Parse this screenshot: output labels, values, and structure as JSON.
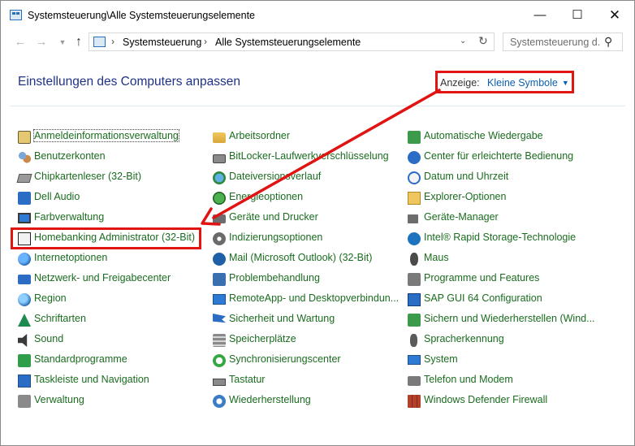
{
  "window": {
    "title": "Systemsteuerung\\Alle Systemsteuerungselemente"
  },
  "address": {
    "crumbs": [
      "Systemsteuerung",
      "Alle Systemsteuerungselemente"
    ],
    "search_placeholder": "Systemsteuerung d..."
  },
  "header": {
    "title": "Einstellungen des Computers anpassen",
    "view_label": "Anzeige:",
    "view_value": "Kleine Symbole"
  },
  "colors": {
    "link_green": "#1a6c1f",
    "title_blue": "#1e3287",
    "accent_blue": "#0a5fb0",
    "highlight_red": "#e11414"
  },
  "columns": [
    {
      "items": [
        {
          "label": "Anmeldeinformationsverwaltung",
          "icon": "credential-manager-icon",
          "kind": "panel",
          "focused": true
        },
        {
          "label": "Benutzerkonten",
          "icon": "user-accounts-icon",
          "kind": "users"
        },
        {
          "label": "Chipkartenleser (32-Bit)",
          "icon": "smart-card-reader-icon",
          "kind": "card"
        },
        {
          "label": "Dell Audio",
          "icon": "dell-audio-icon",
          "kind": "dell"
        },
        {
          "label": "Farbverwaltung",
          "icon": "color-management-icon",
          "kind": "monitor"
        },
        {
          "label": "Homebanking Administrator (32-Bit)",
          "icon": "homebanking-icon",
          "kind": "bank"
        },
        {
          "label": "Internetoptionen",
          "icon": "internet-options-icon",
          "kind": "globe"
        },
        {
          "label": "Netzwerk- und Freigabecenter",
          "icon": "network-icon",
          "kind": "network"
        },
        {
          "label": "Region",
          "icon": "region-icon",
          "kind": "region"
        },
        {
          "label": "Schriftarten",
          "icon": "fonts-icon",
          "kind": "font"
        },
        {
          "label": "Sound",
          "icon": "sound-icon",
          "kind": "speaker"
        },
        {
          "label": "Standardprogramme",
          "icon": "default-programs-icon",
          "kind": "default"
        },
        {
          "label": "Taskleiste und Navigation",
          "icon": "taskbar-icon",
          "kind": "taskbar"
        },
        {
          "label": "Verwaltung",
          "icon": "administrative-tools-icon",
          "kind": "admin"
        }
      ]
    },
    {
      "items": [
        {
          "label": "Arbeitsordner",
          "icon": "work-folders-icon",
          "kind": "folder"
        },
        {
          "label": "BitLocker-Laufwerkverschlüsselung",
          "icon": "bitlocker-icon",
          "kind": "lock"
        },
        {
          "label": "Dateiversionsverlauf",
          "icon": "file-history-icon",
          "kind": "clockglobe"
        },
        {
          "label": "Energieoptionen",
          "icon": "power-options-icon",
          "kind": "play"
        },
        {
          "label": "Geräte und Drucker",
          "icon": "devices-printers-icon",
          "kind": "printer"
        },
        {
          "label": "Indizierungsoptionen",
          "icon": "indexing-options-icon",
          "kind": "gear"
        },
        {
          "label": "Mail (Microsoft Outlook) (32-Bit)",
          "icon": "mail-icon",
          "kind": "mail"
        },
        {
          "label": "Problembehandlung",
          "icon": "troubleshooting-icon",
          "kind": "tool"
        },
        {
          "label": "RemoteApp- und Desktopverbindun...",
          "icon": "remoteapp-icon",
          "kind": "remote"
        },
        {
          "label": "Sicherheit und Wartung",
          "icon": "security-flag-icon",
          "kind": "flag"
        },
        {
          "label": "Speicherplätze",
          "icon": "storage-spaces-icon",
          "kind": "stack"
        },
        {
          "label": "Synchronisierungscenter",
          "icon": "sync-center-icon",
          "kind": "sync"
        },
        {
          "label": "Tastatur",
          "icon": "keyboard-icon",
          "kind": "keyboard"
        },
        {
          "label": "Wiederherstellung",
          "icon": "recovery-icon",
          "kind": "recovery"
        }
      ]
    },
    {
      "items": [
        {
          "label": "Automatische Wiedergabe",
          "icon": "autoplay-icon",
          "kind": "restore"
        },
        {
          "label": "Center für erleichterte Bedienung",
          "icon": "ease-of-access-icon",
          "kind": "access"
        },
        {
          "label": "Datum und Uhrzeit",
          "icon": "date-time-icon",
          "kind": "clock"
        },
        {
          "label": "Explorer-Optionen",
          "icon": "explorer-options-icon",
          "kind": "explorer"
        },
        {
          "label": "Geräte-Manager",
          "icon": "device-manager-icon",
          "kind": "devices"
        },
        {
          "label": "Intel® Rapid Storage-Technologie",
          "icon": "intel-rst-icon",
          "kind": "intel"
        },
        {
          "label": "Maus",
          "icon": "mouse-icon",
          "kind": "mouse"
        },
        {
          "label": "Programme und Features",
          "icon": "programs-features-icon",
          "kind": "program"
        },
        {
          "label": "SAP GUI 64 Configuration",
          "icon": "sap-gui-icon",
          "kind": "sap"
        },
        {
          "label": "Sichern und Wiederherstellen (Wind...",
          "icon": "backup-restore-icon",
          "kind": "backup"
        },
        {
          "label": "Spracherkennung",
          "icon": "speech-recognition-icon",
          "kind": "mic"
        },
        {
          "label": "System",
          "icon": "system-icon",
          "kind": "system"
        },
        {
          "label": "Telefon und Modem",
          "icon": "phone-modem-icon",
          "kind": "phone"
        },
        {
          "label": "Windows Defender Firewall",
          "icon": "firewall-icon",
          "kind": "firewall"
        }
      ]
    }
  ]
}
